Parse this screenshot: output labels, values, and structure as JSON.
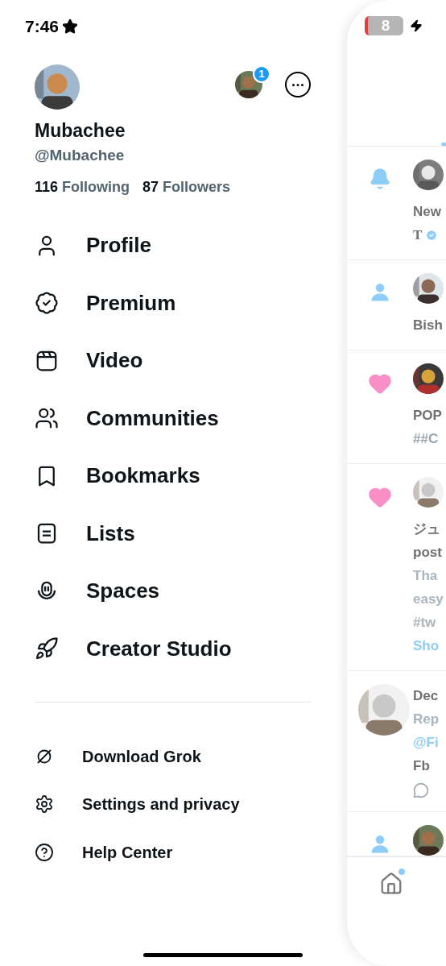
{
  "status_bar": {
    "time": "7:46",
    "battery": "8"
  },
  "profile": {
    "name": "Mubachee",
    "handle": "@Mubachee",
    "following_count": "116",
    "following_label": "Following",
    "followers_count": "87",
    "followers_label": "Followers",
    "account_badge": "1"
  },
  "menu": [
    {
      "label": "Profile"
    },
    {
      "label": "Premium"
    },
    {
      "label": "Video"
    },
    {
      "label": "Communities"
    },
    {
      "label": "Bookmarks"
    },
    {
      "label": "Lists"
    },
    {
      "label": "Spaces"
    },
    {
      "label": "Creator Studio"
    }
  ],
  "secondary_menu": [
    {
      "label": "Download Grok"
    },
    {
      "label": "Settings and privacy"
    },
    {
      "label": "Help Center"
    }
  ],
  "feed": [
    {
      "kind": "bell",
      "lines": [
        {
          "kind": "title",
          "text": "New"
        },
        {
          "kind": "serif",
          "text": "T",
          "verified": true
        }
      ]
    },
    {
      "kind": "person",
      "lines": [
        {
          "kind": "title",
          "text": "Bish"
        }
      ]
    },
    {
      "kind": "like",
      "lines": [
        {
          "kind": "title",
          "text": "POP"
        },
        {
          "kind": "hashtag",
          "text": "##C"
        }
      ]
    },
    {
      "kind": "like",
      "lines": [
        {
          "kind": "title",
          "text": "ジュ"
        },
        {
          "kind": "title",
          "text": "post"
        },
        {
          "kind": "muted",
          "text": "Tha"
        },
        {
          "kind": "muted",
          "text": "easy"
        },
        {
          "kind": "muted",
          "text": "#tw"
        },
        {
          "kind": "link",
          "text": "Sho"
        }
      ]
    },
    {
      "kind": "reply",
      "lines": [
        {
          "kind": "title",
          "text": "Dec"
        },
        {
          "kind": "muted",
          "text": "Rep"
        },
        {
          "kind": "link",
          "text": "@Fi"
        },
        {
          "kind": "title",
          "text": "Fb"
        }
      ]
    },
    {
      "kind": "person"
    }
  ],
  "bottom_nav": {
    "home_has_new": true
  }
}
